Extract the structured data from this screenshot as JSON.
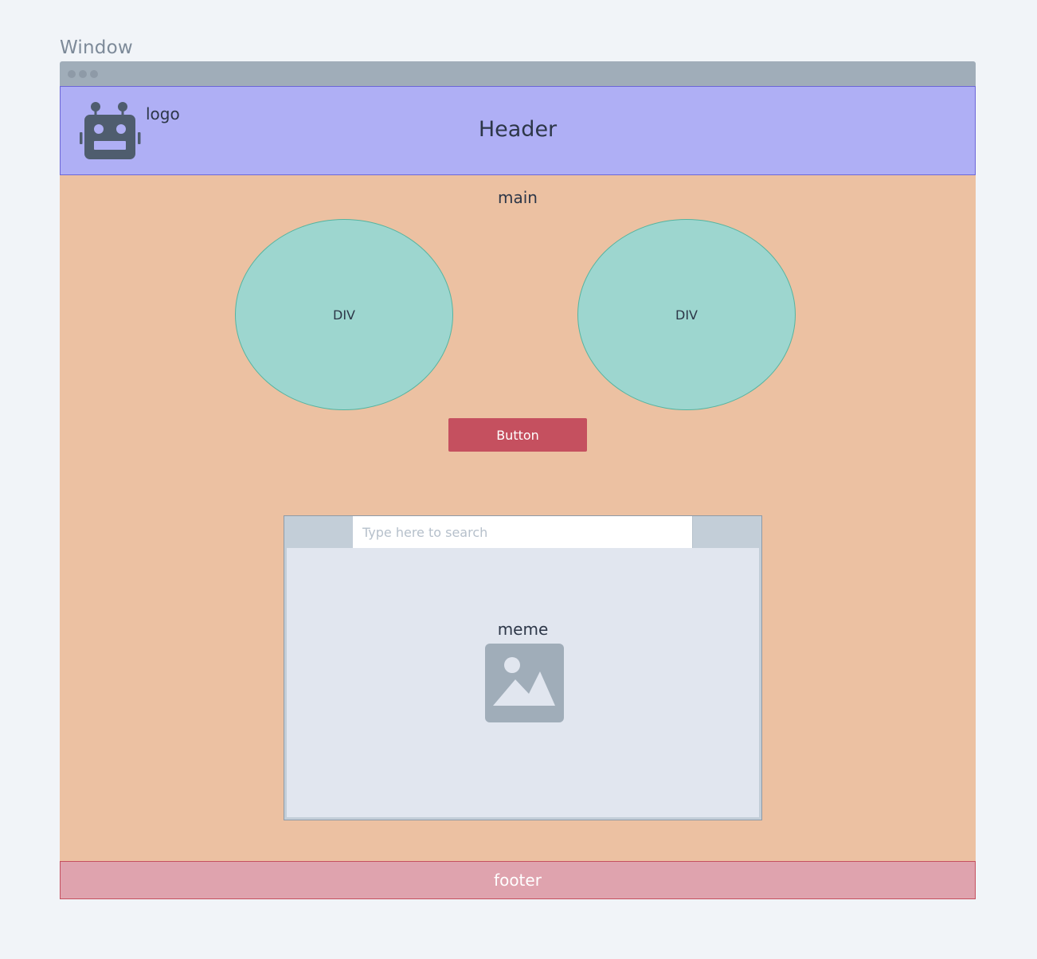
{
  "window": {
    "caption": "Window"
  },
  "header": {
    "logo_icon": "robot-icon",
    "logo_label": "logo",
    "title": "Header"
  },
  "main": {
    "label": "main",
    "circles": [
      {
        "label": "DIV"
      },
      {
        "label": "DIV"
      }
    ],
    "button_label": "Button",
    "browser": {
      "search_placeholder": "Type here to search",
      "content_label": "meme",
      "content_icon": "image-placeholder-icon"
    }
  },
  "footer": {
    "label": "footer"
  },
  "colors": {
    "page_background": "#f1f4f8",
    "titlebar": "#a0adb9",
    "header_fill": "#afaff5",
    "header_border": "#6c66d8",
    "main_fill": "#ecc1a2",
    "circle_fill": "#9dd6cf",
    "circle_border": "#55b4a0",
    "button_fill": "#c5505f",
    "browser_frame": "#c3ced8",
    "browser_body": "#e1e6ef",
    "icon_color": "#4f5d6e",
    "image_icon_color": "#a0adb9",
    "footer_fill": "#dfa3ae",
    "footer_border": "#c5505f"
  }
}
